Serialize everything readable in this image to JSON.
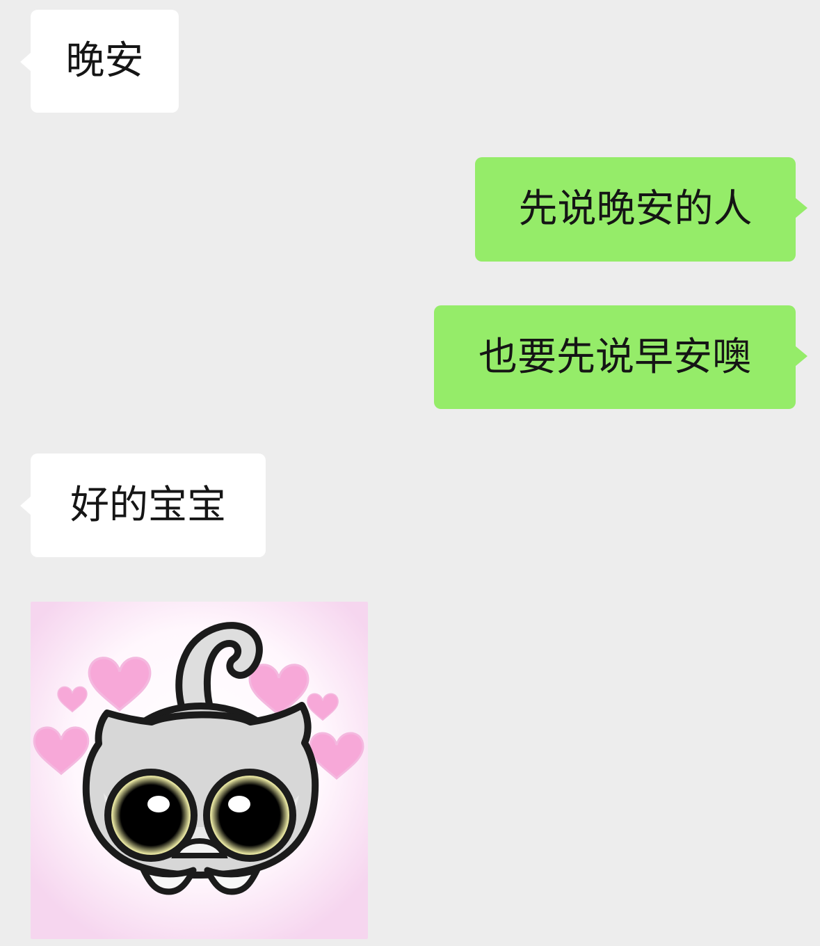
{
  "chat": {
    "messages": [
      {
        "side": "received",
        "type": "text",
        "text": "晚安"
      },
      {
        "side": "sent",
        "type": "text",
        "text": "先说晚安的人"
      },
      {
        "side": "sent",
        "type": "text",
        "text": "也要先说早安噢"
      },
      {
        "side": "received",
        "type": "text",
        "text": "好的宝宝"
      },
      {
        "side": "received",
        "type": "sticker",
        "sticker": "gray-kitten-with-hearts-sticker"
      }
    ]
  },
  "colors": {
    "background": "#ededed",
    "received_bubble": "#ffffff",
    "sent_bubble": "#95ec69",
    "text": "#151515",
    "heart": "#f7a8d8"
  }
}
